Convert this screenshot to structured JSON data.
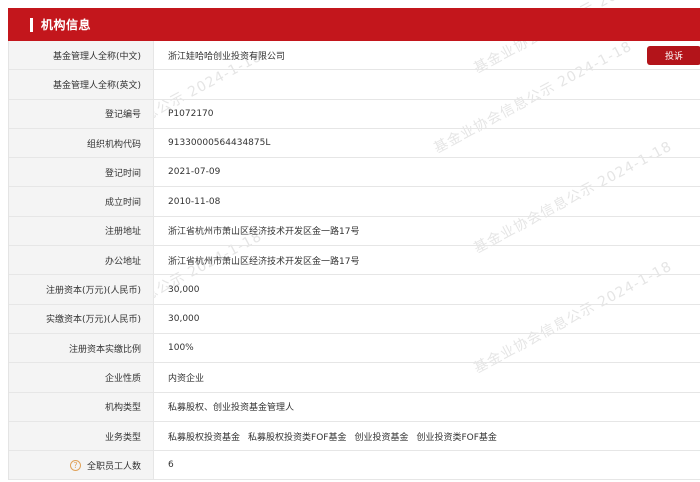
{
  "header": {
    "title": "机构信息"
  },
  "report_button": "投诉",
  "watermark": "基金业协会信息公示 2024-1-18",
  "rows": [
    {
      "label": "基金管理人全称(中文)",
      "value": "浙江娃哈哈创业投资有限公司"
    },
    {
      "label": "基金管理人全称(英文)",
      "value": ""
    },
    {
      "label": "登记编号",
      "value": "P1072170"
    },
    {
      "label": "组织机构代码",
      "value": "91330000564434875L"
    },
    {
      "label": "登记时间",
      "value": "2021-07-09"
    },
    {
      "label": "成立时间",
      "value": "2010-11-08"
    },
    {
      "label": "注册地址",
      "value": "浙江省杭州市萧山区经济技术开发区金一路17号"
    },
    {
      "label": "办公地址",
      "value": "浙江省杭州市萧山区经济技术开发区金一路17号"
    },
    {
      "label": "注册资本(万元)(人民币)",
      "value": "30,000"
    },
    {
      "label": "实缴资本(万元)(人民币)",
      "value": "30,000"
    },
    {
      "label": "注册资本实缴比例",
      "value": "100%"
    },
    {
      "label": "企业性质",
      "value": "内资企业"
    },
    {
      "label": "机构类型",
      "value": "私募股权、创业投资基金管理人"
    },
    {
      "label": "业务类型",
      "values": [
        "私募股权投资基金",
        "私募股权投资类FOF基金",
        "创业投资基金",
        "创业投资类FOF基金"
      ]
    },
    {
      "label": "全职员工人数",
      "value": "6",
      "help_icon": "question-circle-icon"
    }
  ]
}
